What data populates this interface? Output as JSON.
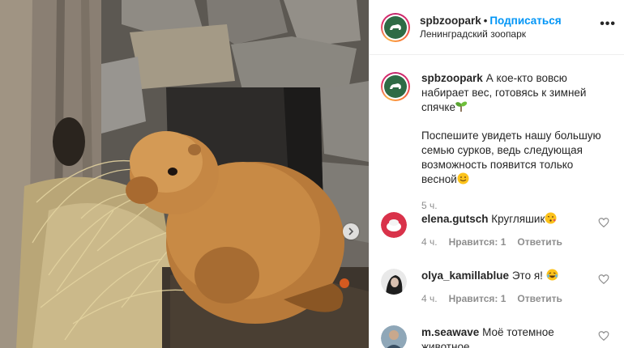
{
  "post": {
    "image": {
      "subject": "marmot-on-hay"
    },
    "username": "spbzoopark",
    "separator": "•",
    "follow_label": "Подписаться",
    "location": "Ленинградский зоопарк",
    "more_label": "•••",
    "caption_line1": "А кое-кто вовсю набирает вес, готовясь к зимней спячке",
    "caption_line2": "Поспешите увидеть нашу большую семью сурков, ведь следующая возможность появится только весной",
    "time": "5 ч."
  },
  "comments": [
    {
      "username": "elena.gutsch",
      "text": "Кругляшик",
      "time": "4 ч.",
      "likes": "Нравится: 1",
      "reply": "Ответить",
      "emoji": "face-blowing-kiss"
    },
    {
      "username": "olya_kamillablue",
      "text": "Это я!",
      "time": "4 ч.",
      "likes": "Нравится: 1",
      "reply": "Ответить",
      "emoji": "face-tears-of-joy"
    },
    {
      "username": "m.seawave",
      "text": "Моё тотемное",
      "text_cont": "животное"
    }
  ],
  "colors": {
    "link": "#0095f6",
    "meta": "#8e8e8e",
    "logo_green": "#2e6b45"
  }
}
